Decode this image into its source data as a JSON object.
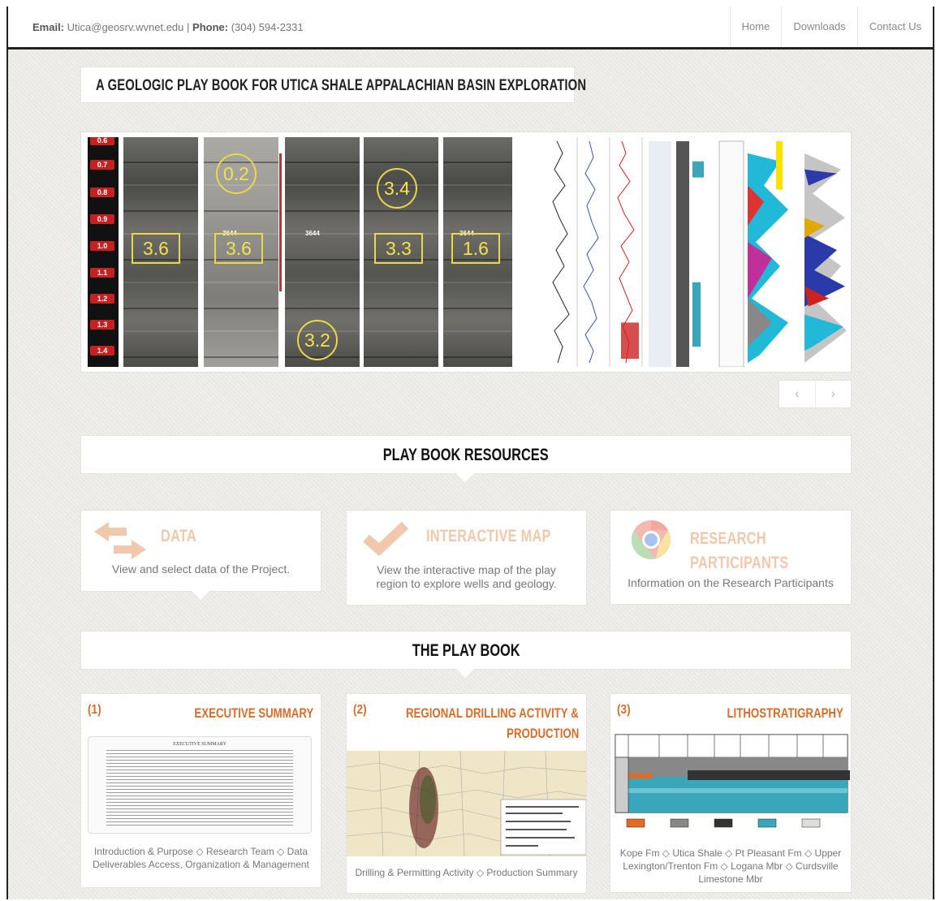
{
  "topbar": {
    "email_label": "Email:",
    "email_value": "Utica@geosrv.wvnet.edu",
    "separator": "|",
    "phone_label": "Phone:",
    "phone_value": "(304) 594-2331",
    "nav": [
      "Home",
      "Downloads",
      "Contact Us"
    ]
  },
  "page_title": "A GEOLOGIC PLAY BOOK FOR UTICA SHALE APPALACHIAN BASIN EXPLORATION",
  "slider": {
    "depth_ticks": [
      "0.6",
      "0.7",
      "0.8",
      "0.9",
      "1.0",
      "1.1",
      "1.2",
      "1.3",
      "1.4"
    ],
    "core_values": [
      "3.6",
      "0.2",
      "3.6",
      "3.2",
      "3.4",
      "3.3",
      "1.6"
    ],
    "core_labels": [
      "3644",
      "3644",
      "3644"
    ],
    "prev_arrow": "‹",
    "next_arrow": "›"
  },
  "resources": {
    "heading": "PLAY BOOK RESOURCES",
    "cards": [
      {
        "title": "DATA",
        "desc": "View and select data of the Project.",
        "icon": "arrows-exchange-icon"
      },
      {
        "title": "INTERACTIVE MAP",
        "desc": "View the interactive map of the play region to explore wells and geology.",
        "icon": "checkmark-icon"
      },
      {
        "title_line1": "RESEARCH",
        "title_line2": "PARTICIPANTS",
        "desc": "Information on the Research Participants",
        "icon": "chrome-icon"
      }
    ]
  },
  "playbook": {
    "heading": "THE PLAY BOOK",
    "cards": [
      {
        "num": "(1)",
        "title": "EXECUTIVE SUMMARY",
        "doc_heading": "EXECUTIVE SUMMARY",
        "desc": "Introduction & Purpose ◇ Research Team ◇ Data Deliverables Access, Organization & Management"
      },
      {
        "num": "(2)",
        "title_line1": "REGIONAL DRILLING ACTIVITY &",
        "title_line2": "PRODUCTION",
        "desc": "Drilling & Permitting Activity ◇ Production Summary"
      },
      {
        "num": "(3)",
        "title": "LITHOSTRATIGRAPHY",
        "desc": "Kope Fm ◇ Utica Shale ◇ Pt Pleasant Fm ◇ Upper Lexington/Trenton Fm ◇ Logana Mbr ◇ Curdsville Limestone Mbr"
      }
    ]
  },
  "colors": {
    "accent_orange": "#d86d2a",
    "resource_peach": "#f0c8ab",
    "frame_border": "#222222"
  }
}
